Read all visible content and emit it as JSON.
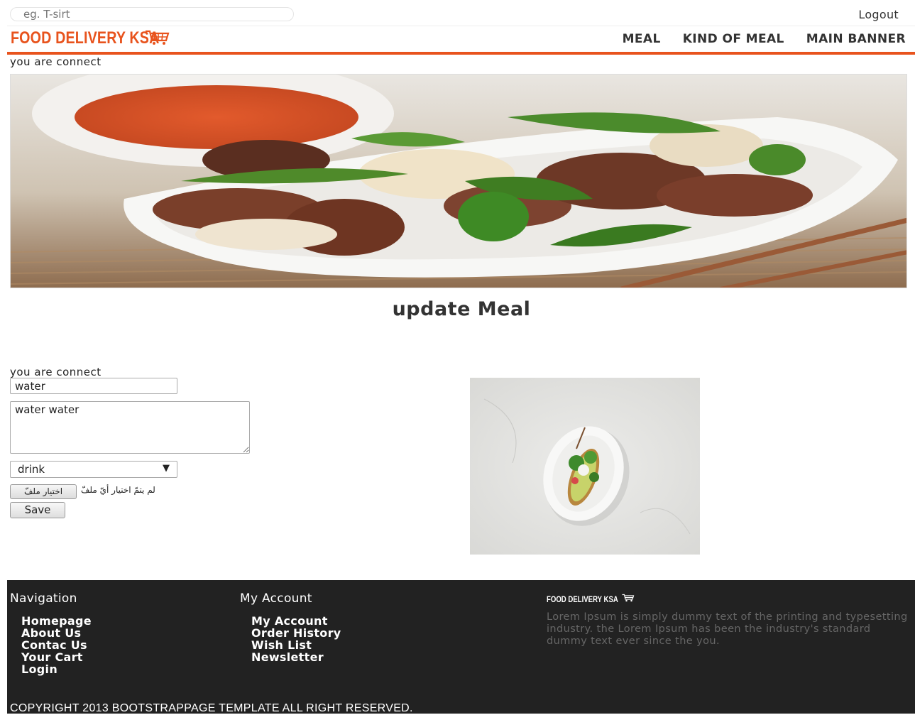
{
  "topbar": {
    "search_placeholder": "eg. T-sirt",
    "logout_label": "Logout"
  },
  "header": {
    "logo_text": "FOOD DELIVERY KSA",
    "nav": [
      "MEAL",
      "KIND OF MEAL",
      "MAIN BANNER"
    ]
  },
  "status_top": "you are connect",
  "page_title": "update Meal",
  "form": {
    "status": "you are connect",
    "name_value": "water",
    "description_value": "water water",
    "kind_selected": "drink",
    "file_button_label": "اختيار ملفّ",
    "file_status": "لم يتمّ اختيار أيّ ملفّ",
    "save_label": "Save"
  },
  "footer": {
    "navigation_title": "Navigation",
    "navigation_links": [
      "Homepage",
      "About Us",
      "Contac Us",
      "Your Cart",
      "Login"
    ],
    "account_title": "My Account",
    "account_links": [
      "My Account",
      "Order History",
      "Wish List",
      "Newsletter"
    ],
    "logo_text": "FOOD DELIVERY KSA",
    "about_text": "Lorem Ipsum is simply dummy text of the printing and typesetting industry. the Lorem Ipsum has been the industry's standard dummy text ever since the you.",
    "copyright": "COPYRIGHT 2013 BOOTSTRAPPAGE TEMPLATE ALL RIGHT RESERVED."
  },
  "colors": {
    "accent": "#e8531d",
    "footer_bg": "#222222"
  },
  "icons": [
    "shopping-cart-icon",
    "dropdown-arrow-icon"
  ]
}
